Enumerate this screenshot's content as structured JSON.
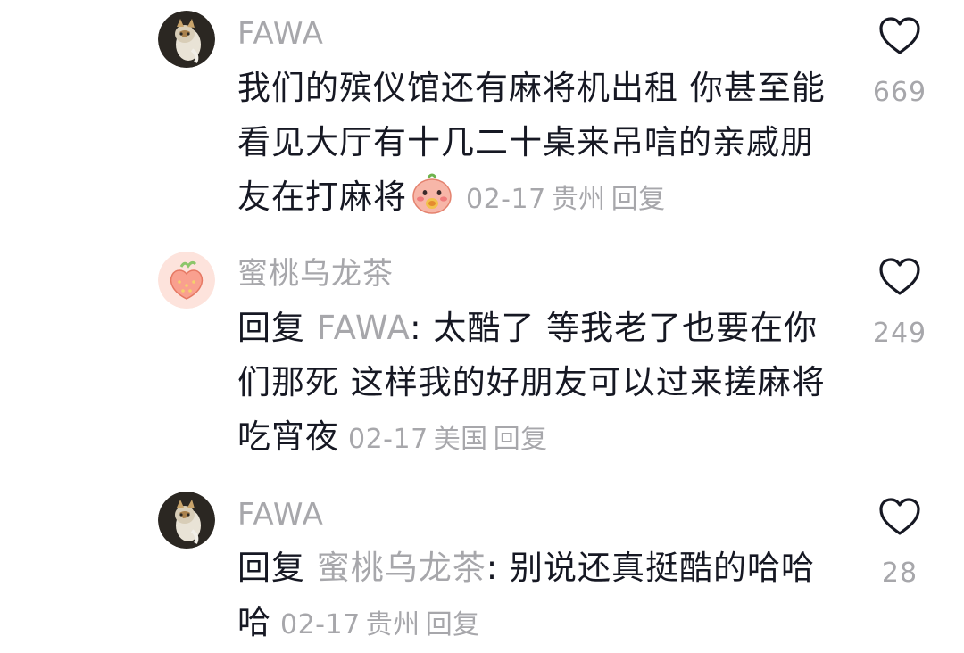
{
  "comments": [
    {
      "username": "FAWA",
      "reply_prefix": "",
      "reply_to": "",
      "reply_suffix": "",
      "text": "我们的殡仪馆还有麻将机出租 你甚至能看见大厅有十几二十桌来吊唁的亲戚朋友在打麻将",
      "emoji": "blush-face-emoji",
      "date": "02-17",
      "location": "贵州",
      "reply_label": "回复",
      "likes": "669",
      "avatar": "cat-avatar"
    },
    {
      "username": "蜜桃乌龙茶",
      "reply_prefix": "回复 ",
      "reply_to": "FAWA",
      "reply_suffix": ": ",
      "text": "太酷了 等我老了也要在你们那死 这样我的好朋友可以过来搓麻将吃宵夜",
      "date": "02-17",
      "location": "美国",
      "reply_label": "回复",
      "likes": "249",
      "avatar": "peach-avatar"
    },
    {
      "username": "FAWA",
      "reply_prefix": "回复 ",
      "reply_to": "蜜桃乌龙茶",
      "reply_suffix": ": ",
      "text": "别说还真挺酷的哈哈哈",
      "date": "02-17",
      "location": "贵州",
      "reply_label": "回复",
      "likes": "28",
      "avatar": "cat-avatar"
    }
  ],
  "colors": {
    "primary_text": "#161823",
    "secondary_text": "#a7a7ab",
    "background": "#ffffff"
  }
}
